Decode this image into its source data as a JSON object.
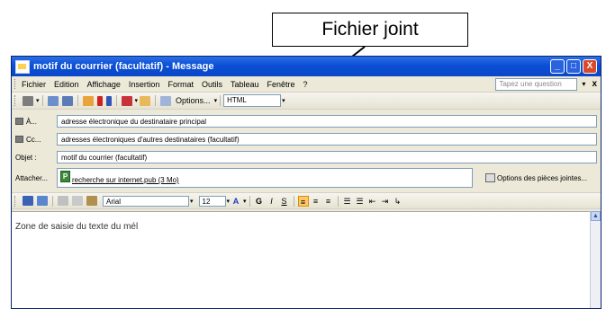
{
  "annotation": {
    "callout_text": "Fichier joint"
  },
  "window": {
    "title": "motif du courrier (facultatif) - Message",
    "buttons": [
      "_",
      "□",
      "X"
    ]
  },
  "menubar": {
    "items": [
      "Fichier",
      "Edition",
      "Affichage",
      "Insertion",
      "Format",
      "Outils",
      "Tableau",
      "Fenêtre",
      "?"
    ],
    "ask_placeholder": "Tapez une question",
    "close": "x"
  },
  "toolbar": {
    "options_label": "Options...",
    "format_value": "HTML"
  },
  "fields": {
    "to": {
      "label": "À...",
      "value": "adresse électronique du destinataire principal"
    },
    "cc": {
      "label": "Cc...",
      "value": "adresses électroniques d'autres destinataires (facultatif)"
    },
    "subject": {
      "label": "Objet :",
      "value": "motif du courrier (facultatif)"
    },
    "attach": {
      "label": "Attacher...",
      "file_name": "recherche sur internet.pub (3 Mo)",
      "options_label": "Options des pièces jointes..."
    }
  },
  "formatting": {
    "font": "Arial",
    "size": "12",
    "bold": "G",
    "italic": "I",
    "underline": "S"
  },
  "body": {
    "text": "Zone de saisie du texte du mél"
  },
  "colors": {
    "titlebar": "#0a47c8",
    "chrome": "#ece9d8",
    "close_button": "#d84a2a"
  }
}
